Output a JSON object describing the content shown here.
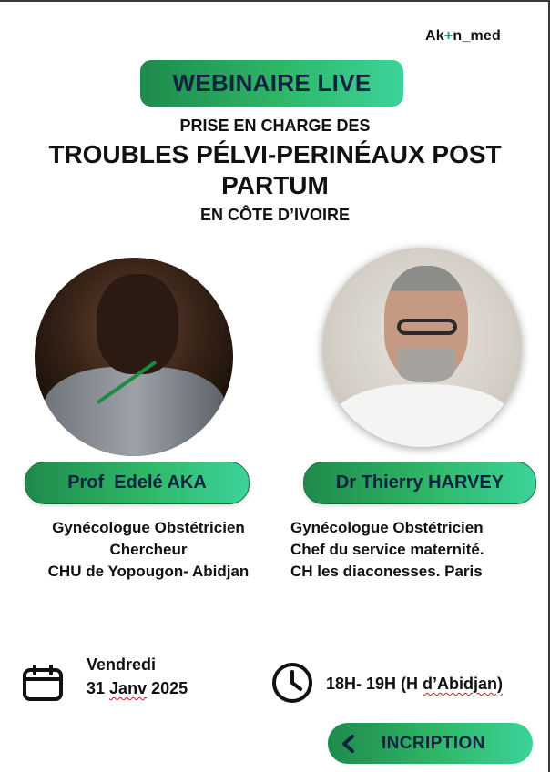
{
  "brand": {
    "prefix": "Ak",
    "plus": "+",
    "suffix": "n_med"
  },
  "banner": {
    "label": "WEBINAIRE LIVE"
  },
  "topic": {
    "intro": "PRISE EN CHARGE DES",
    "title_line1": "TROUBLES PÉLVI-PERINÉAUX POST",
    "title_line2": "PARTUM",
    "location": "EN CÔTE D’IVOIRE"
  },
  "speakers": [
    {
      "name": "Prof  Edelé AKA",
      "roles": [
        "Gynécologue Obstétricien",
        "Chercheur",
        "CHU de Yopougon- Abidjan"
      ]
    },
    {
      "name": "Dr Thierry HARVEY",
      "roles": [
        "Gynécologue Obstétricien",
        "Chef du service maternité.",
        "CH les diaconesses. Paris"
      ]
    }
  ],
  "schedule": {
    "day": "Vendredi",
    "date_day": "31",
    "date_month": "Janv",
    "date_year": "2025",
    "time_main": "18H- 19H (H",
    "time_zone": "d’Abidjan)"
  },
  "cta": {
    "label": "INCRIPTION"
  },
  "colors": {
    "accent_start": "#1f8a4c",
    "accent_end": "#3cd39a",
    "text_dark": "#0f2340"
  },
  "icons": [
    "calendar-icon",
    "clock-icon",
    "chevron-left-icon"
  ]
}
